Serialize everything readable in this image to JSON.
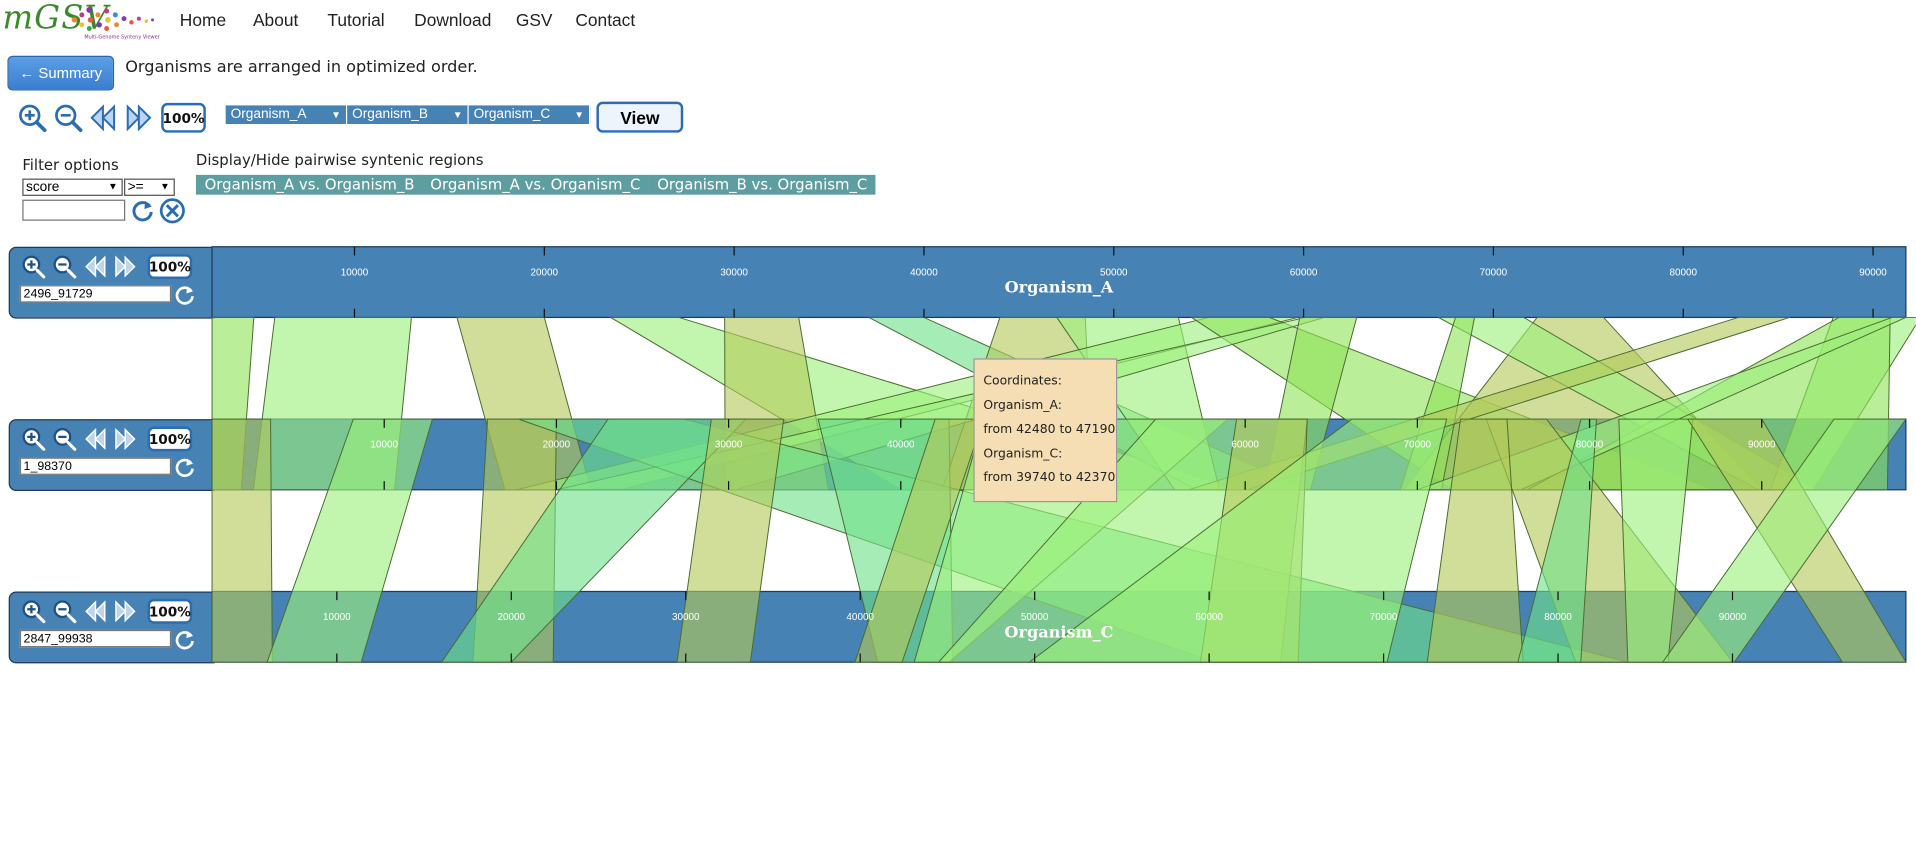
{
  "app": {
    "logo_text": "mGSV",
    "logo_subtitle": "Multi-Genome Synteny Viewer"
  },
  "nav": {
    "items": [
      "Home",
      "About",
      "Tutorial",
      "Download",
      "GSV",
      "Contact"
    ]
  },
  "summary": {
    "button_label": "← Summary",
    "order_text": "Organisms are arranged in optimized order."
  },
  "toolbar": {
    "zoom_pct_label": "100%",
    "organism_selects": [
      "Organism_A",
      "Organism_B",
      "Organism_C"
    ],
    "view_label": "View",
    "icons": [
      "zoom-in-icon",
      "zoom-out-icon",
      "pan-left-icon",
      "pan-right-icon"
    ]
  },
  "filter": {
    "label": "Filter options",
    "field_value": "score",
    "operator_value": ">=",
    "value_input": "",
    "icons": [
      "refresh-icon",
      "clear-icon"
    ]
  },
  "pairwise": {
    "label": "Display/Hide pairwise syntenic regions",
    "buttons": [
      "Organism_A vs. Organism_B",
      "Organism_A vs. Organism_C",
      "Organism_B vs. Organism_C"
    ],
    "button_color": "#5f9ea0"
  },
  "tracks": [
    {
      "organism": "Organism_A",
      "title": "Organism_A",
      "range": "2496_91729",
      "start": 2496,
      "end": 91729,
      "ticks": [
        10000,
        20000,
        30000,
        40000,
        50000,
        60000,
        70000,
        80000,
        90000
      ],
      "zoom_pct_label": "100%"
    },
    {
      "organism": "Organism_B",
      "title": "",
      "range": "1_98370",
      "start": 1,
      "end": 98370,
      "ticks": [
        10000,
        20000,
        30000,
        40000,
        50000,
        60000,
        70000,
        80000,
        90000
      ],
      "zoom_pct_label": "100%"
    },
    {
      "organism": "Organism_C",
      "title": "Organism_C",
      "range": "2847_99938",
      "start": 2847,
      "end": 99938,
      "ticks": [
        10000,
        20000,
        30000,
        40000,
        50000,
        60000,
        70000,
        80000,
        90000
      ],
      "zoom_pct_label": "100%"
    }
  ],
  "synteny": {
    "colors": {
      "direct": "#8fe35a",
      "olive": "#b3c95a",
      "light": "#9df07d",
      "mint": "#6fe08a"
    },
    "track_color": "#4682b4",
    "regions_ab": [
      [
        2496,
        4700,
        1,
        1700,
        "direct"
      ],
      [
        5800,
        13000,
        2400,
        10600,
        "light"
      ],
      [
        15400,
        20000,
        17000,
        22000,
        "olive"
      ],
      [
        23500,
        27100,
        40000,
        59700,
        "light"
      ],
      [
        37100,
        40000,
        57200,
        63600,
        "mint"
      ],
      [
        29500,
        33400,
        29800,
        35800,
        "olive"
      ],
      [
        44000,
        48500,
        42400,
        51200,
        "olive"
      ],
      [
        47000,
        53400,
        55900,
        58500,
        "light"
      ],
      [
        55000,
        59700,
        17700,
        23700,
        "light"
      ],
      [
        54100,
        58200,
        72000,
        87200,
        "direct"
      ],
      [
        60100,
        61100,
        20000,
        30400,
        "light"
      ],
      [
        59800,
        62800,
        61100,
        63800,
        "direct"
      ],
      [
        72300,
        75800,
        69200,
        90000,
        "olive"
      ],
      [
        67100,
        71600,
        89800,
        93200,
        "light"
      ],
      [
        68000,
        69000,
        69000,
        71400,
        "direct"
      ],
      [
        82900,
        85600,
        56700,
        60100,
        "olive"
      ],
      [
        87900,
        92500,
        90500,
        93000,
        "light"
      ],
      [
        88200,
        90900,
        76400,
        97300,
        "direct"
      ],
      [
        91000,
        91729,
        70000,
        76000,
        "light"
      ]
    ],
    "regions_bc": [
      [
        1,
        3400,
        2847,
        6300,
        "olive"
      ],
      [
        8200,
        12800,
        6000,
        11400,
        "light"
      ],
      [
        16000,
        20000,
        17800,
        22400,
        "olive"
      ],
      [
        17800,
        27400,
        60300,
        84000,
        "mint"
      ],
      [
        23000,
        31000,
        16000,
        20000,
        "mint"
      ],
      [
        29000,
        33200,
        29500,
        33700,
        "olive"
      ],
      [
        35200,
        42800,
        41000,
        45300,
        "mint"
      ],
      [
        42000,
        44800,
        39700,
        42400,
        "olive"
      ],
      [
        44800,
        59000,
        43100,
        45100,
        "light"
      ],
      [
        54800,
        63600,
        44500,
        64100,
        "light"
      ],
      [
        59500,
        63600,
        59500,
        65100,
        "olive"
      ],
      [
        66200,
        71700,
        49700,
        70200,
        "light"
      ],
      [
        74000,
        77500,
        81000,
        90000,
        "olive"
      ],
      [
        72500,
        75200,
        72500,
        78000,
        "olive"
      ],
      [
        79500,
        80400,
        77700,
        81300,
        "mint"
      ],
      [
        81700,
        86000,
        84000,
        86300,
        "light"
      ],
      [
        85700,
        90000,
        96300,
        99938,
        "olive"
      ],
      [
        94200,
        98370,
        86000,
        90100,
        "light"
      ]
    ]
  },
  "tooltip": {
    "line1": "Coordinates:",
    "line2": "Organism_A:",
    "line3": "from 42480 to 47190",
    "line4": "Organism_C:",
    "line5": "from 39740 to 42370"
  }
}
